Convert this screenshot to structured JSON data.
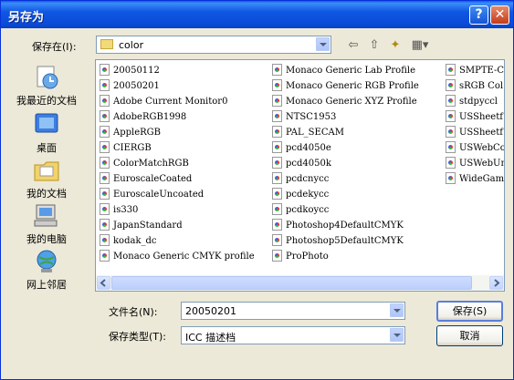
{
  "window": {
    "title": "另存为"
  },
  "toolbar": {
    "save_in_label": "保存在(I):",
    "current_folder": "color"
  },
  "places": [
    {
      "label": "我最近的文档",
      "icon": "recent-documents-icon"
    },
    {
      "label": "桌面",
      "icon": "desktop-icon"
    },
    {
      "label": "我的文档",
      "icon": "my-documents-icon"
    },
    {
      "label": "我的电脑",
      "icon": "my-computer-icon"
    },
    {
      "label": "网上邻居",
      "icon": "network-places-icon"
    }
  ],
  "files": {
    "col1": [
      "20050112",
      "20050201",
      "Adobe Current Monitor0",
      "AdobeRGB1998",
      "AppleRGB",
      "CIERGB",
      "ColorMatchRGB",
      "EuroscaleCoated",
      "EuroscaleUncoated",
      "is330",
      "JapanStandard",
      "kodak_dc",
      "Monaco Generic CMYK profile"
    ],
    "col2": [
      "Monaco Generic Lab Profile",
      "Monaco Generic RGB Profile",
      "Monaco Generic XYZ Profile",
      "NTSC1953",
      "PAL_SECAM",
      "pcd4050e",
      "pcd4050k",
      "pcdcnycc",
      "pcdekycc",
      "pcdkoycc",
      "Photoshop4DefaultCMYK",
      "Photoshop5DefaultCMYK",
      "ProPhoto"
    ],
    "col3": [
      "SMPTE-C",
      "sRGB Col",
      "stdpyccl",
      "USSheetf",
      "USSheetf",
      "USWebCoa",
      "USWebUnc",
      "WideGamu"
    ]
  },
  "form": {
    "filename_label": "文件名(N):",
    "filename_value": "20050201",
    "filetype_label": "保存类型(T):",
    "filetype_value": "ICC 描述档"
  },
  "buttons": {
    "save": "保存(S)",
    "cancel": "取消"
  }
}
